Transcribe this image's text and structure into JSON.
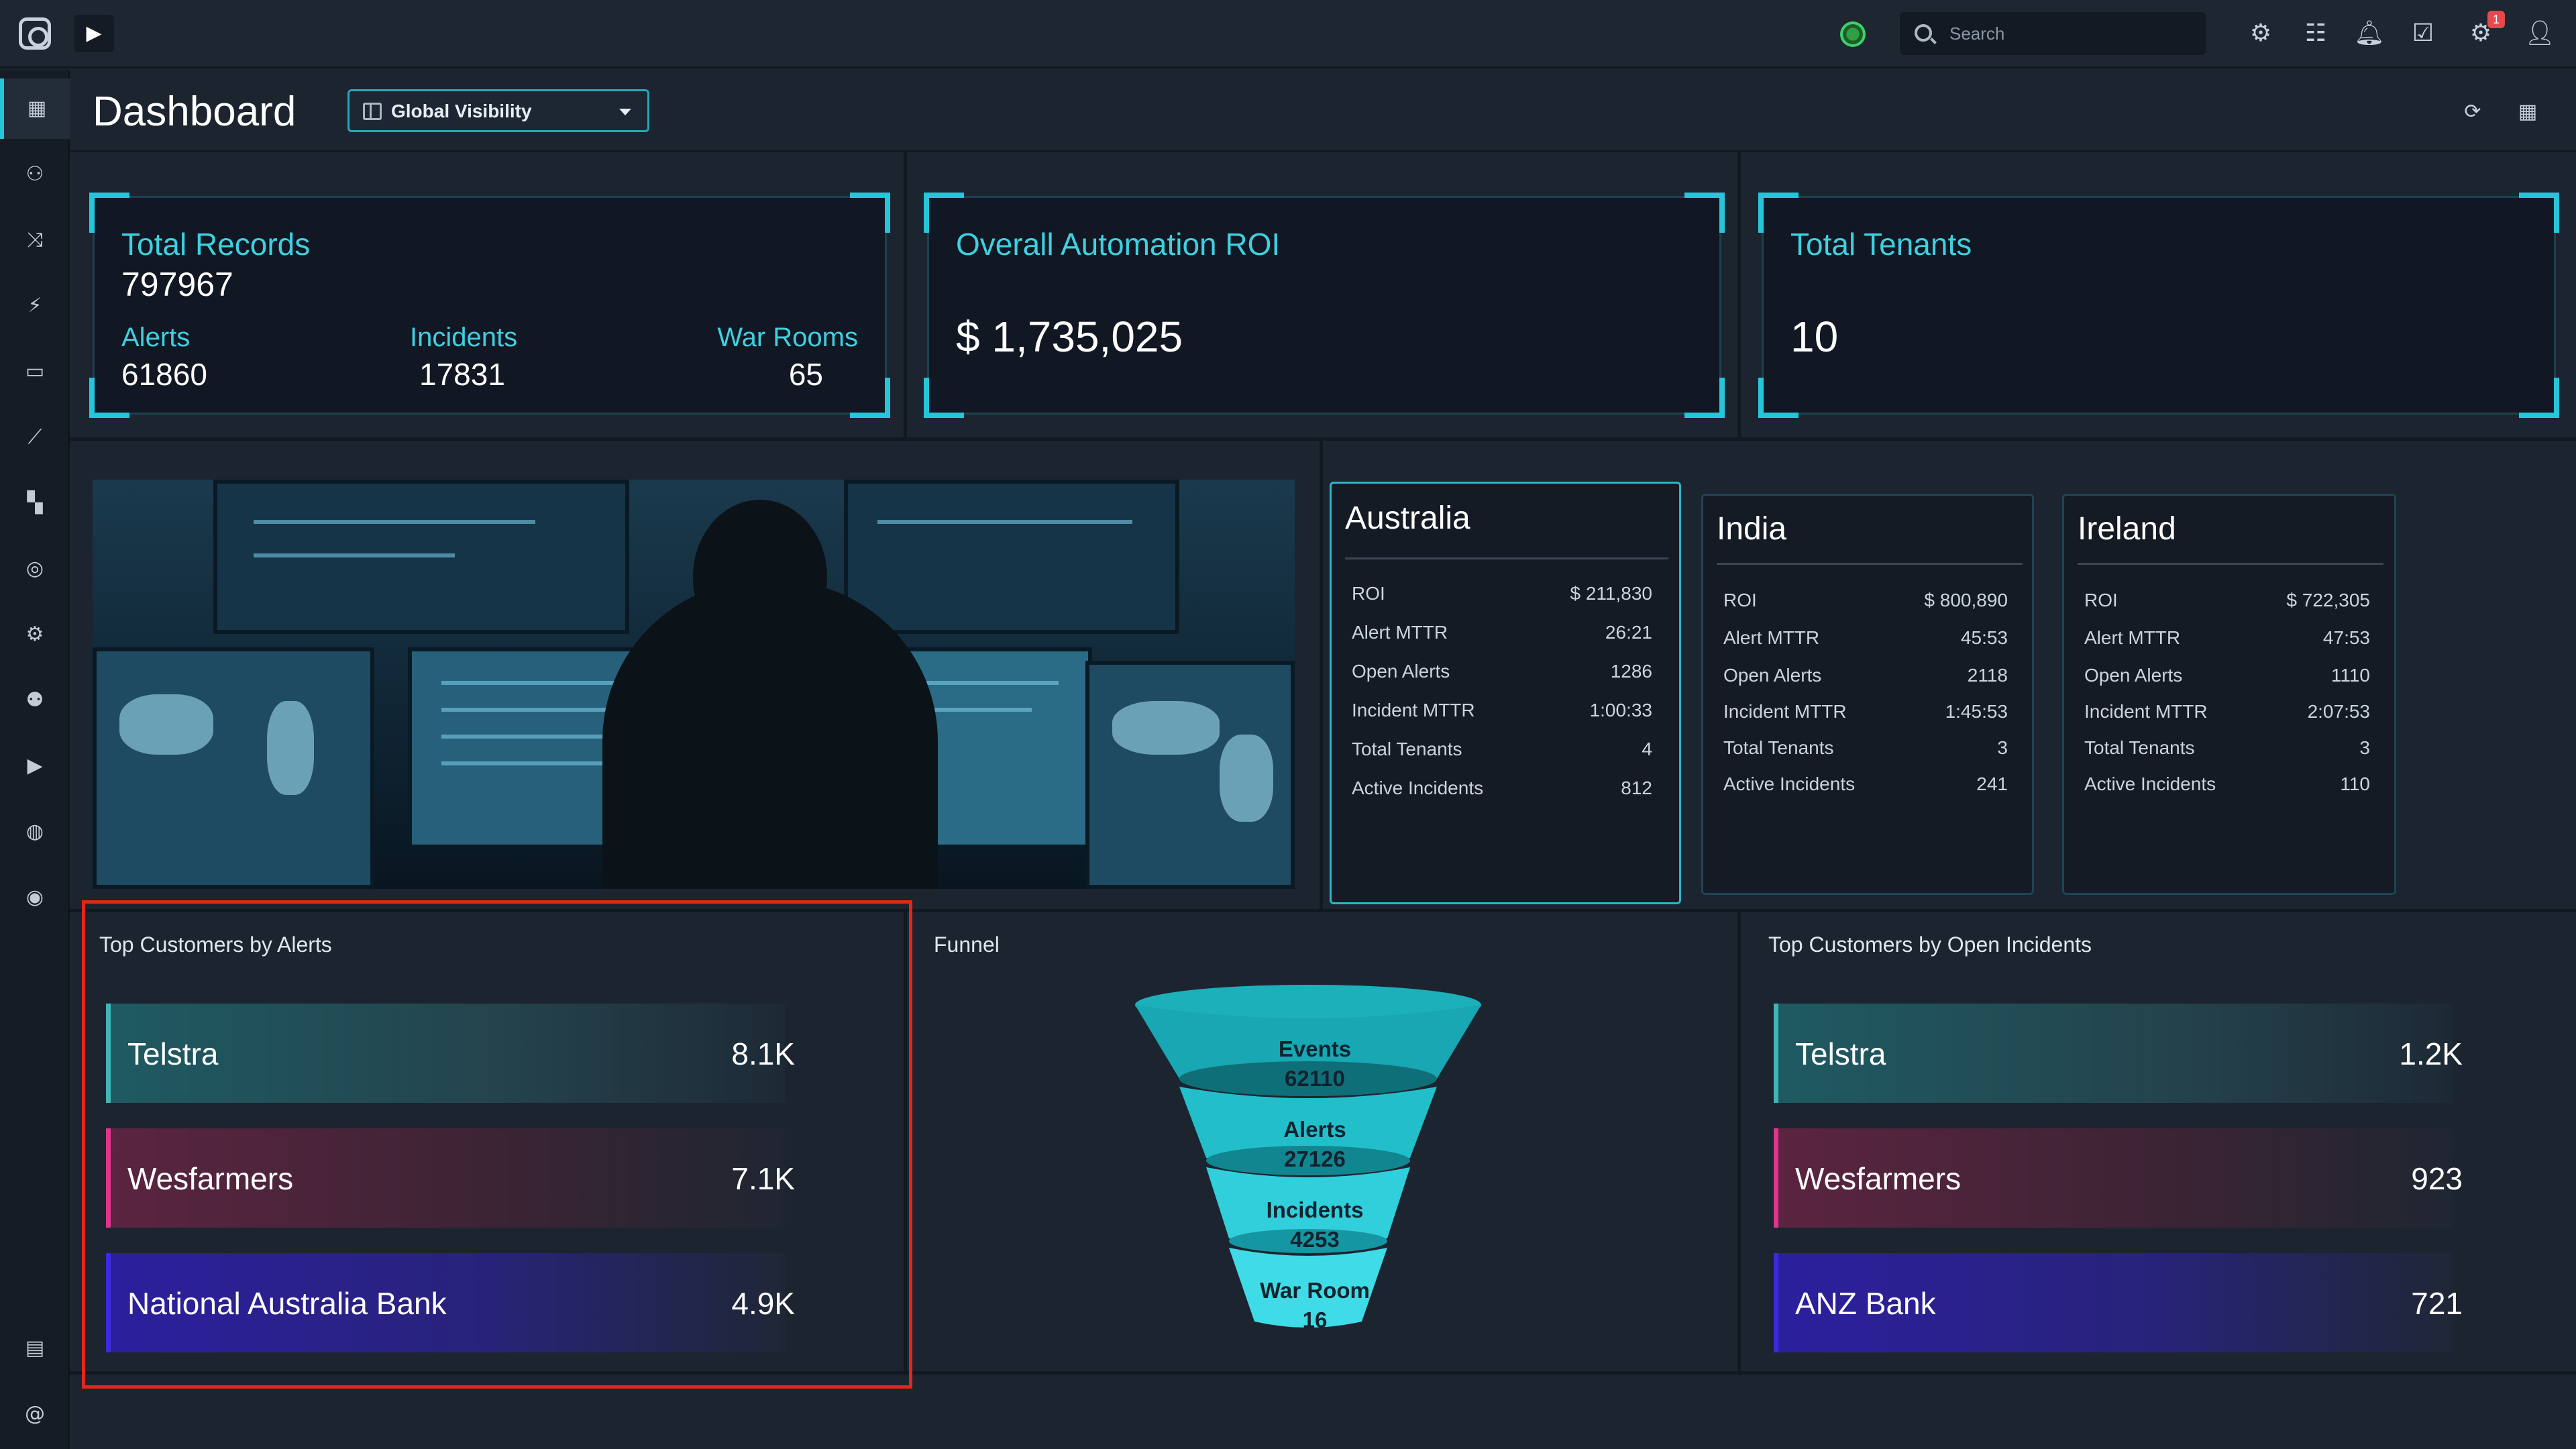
{
  "topbar": {
    "search_placeholder": "Search",
    "notification_count": "1"
  },
  "header": {
    "title": "Dashboard",
    "visibility_label": "Global Visibility"
  },
  "kpis": {
    "records": {
      "title": "Total Records",
      "value": "797967",
      "alerts_label": "Alerts",
      "alerts_value": "61860",
      "incidents_label": "Incidents",
      "incidents_value": "17831",
      "warrooms_label": "War Rooms",
      "warrooms_value": "65"
    },
    "roi": {
      "title": "Overall Automation ROI",
      "value": "$ 1,735,025"
    },
    "tenants": {
      "title": "Total Tenants",
      "value": "10"
    }
  },
  "regions": [
    {
      "name": "Australia",
      "rows": [
        {
          "label": "ROI",
          "value": "$ 211,830"
        },
        {
          "label": "Alert MTTR",
          "value": "26:21"
        },
        {
          "label": "Open Alerts",
          "value": "1286"
        },
        {
          "label": "Incident MTTR",
          "value": "1:00:33"
        },
        {
          "label": "Total Tenants",
          "value": "4"
        },
        {
          "label": "Active Incidents",
          "value": "812"
        }
      ]
    },
    {
      "name": "India",
      "rows": [
        {
          "label": "ROI",
          "value": "$ 800,890"
        },
        {
          "label": "Alert MTTR",
          "value": "45:53"
        },
        {
          "label": "Open Alerts",
          "value": "2118"
        },
        {
          "label": "Incident MTTR",
          "value": "1:45:53"
        },
        {
          "label": "Total Tenants",
          "value": "3"
        },
        {
          "label": "Active Incidents",
          "value": "241"
        }
      ]
    },
    {
      "name": "Ireland",
      "rows": [
        {
          "label": "ROI",
          "value": "$ 722,305"
        },
        {
          "label": "Alert MTTR",
          "value": "47:53"
        },
        {
          "label": "Open Alerts",
          "value": "1110"
        },
        {
          "label": "Incident MTTR",
          "value": "2:07:53"
        },
        {
          "label": "Total Tenants",
          "value": "3"
        },
        {
          "label": "Active Incidents",
          "value": "110"
        }
      ]
    }
  ],
  "top_alerts": {
    "title": "Top Customers by Alerts",
    "items": [
      {
        "name": "Telstra",
        "value": "8.1K"
      },
      {
        "name": "Wesfarmers",
        "value": "7.1K"
      },
      {
        "name": "National Australia Bank",
        "value": "4.9K"
      }
    ]
  },
  "funnel": {
    "title": "Funnel",
    "stages": [
      {
        "label": "Events",
        "value": "62110"
      },
      {
        "label": "Alerts",
        "value": "27126"
      },
      {
        "label": "Incidents",
        "value": "4253"
      },
      {
        "label": "War Room",
        "value": "16"
      }
    ]
  },
  "top_incidents": {
    "title": "Top Customers by Open Incidents",
    "items": [
      {
        "name": "Telstra",
        "value": "1.2K"
      },
      {
        "name": "Wesfarmers",
        "value": "923"
      },
      {
        "name": "ANZ Bank",
        "value": "721"
      }
    ]
  },
  "colors": {
    "accent": "#26c6da",
    "teal_bar": "#3fb5b8",
    "magenta_bar": "#e0358c",
    "indigo_bar": "#3b2ae0",
    "highlight": "#e2261a"
  }
}
